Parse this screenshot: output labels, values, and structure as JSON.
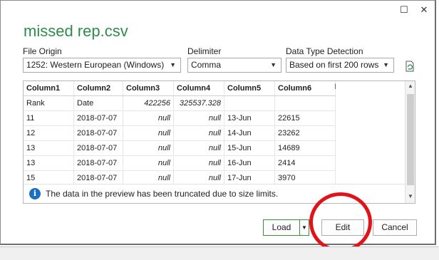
{
  "window": {
    "title": "missed rep.csv",
    "minimize_glyph": "☐",
    "close_glyph": "✕"
  },
  "options": {
    "file_origin_label": "File Origin",
    "file_origin_value": "1252: Western European (Windows)",
    "delimiter_label": "Delimiter",
    "delimiter_value": "Comma",
    "detection_label": "Data Type Detection",
    "detection_value": "Based on first 200 rows"
  },
  "grid": {
    "columns": [
      "Column1",
      "Column2",
      "Column3",
      "Column4",
      "Column5",
      "Column6"
    ],
    "partial_column": "I",
    "rows": [
      [
        "Rank",
        "Date",
        "422256",
        "325537.328",
        "",
        ""
      ],
      [
        "11",
        "2018-07-07",
        "null",
        "null",
        "13-Jun",
        "22615"
      ],
      [
        "12",
        "2018-07-07",
        "null",
        "null",
        "14-Jun",
        "23262"
      ],
      [
        "13",
        "2018-07-07",
        "null",
        "null",
        "15-Jun",
        "14689"
      ],
      [
        "13",
        "2018-07-07",
        "null",
        "null",
        "16-Jun",
        "2414"
      ],
      [
        "15",
        "2018-07-07",
        "null",
        "null",
        "17-Jun",
        "3970"
      ]
    ],
    "truncation_message": "The data in the preview has been truncated due to size limits."
  },
  "buttons": {
    "load": "Load",
    "edit": "Edit",
    "cancel": "Cancel"
  },
  "colors": {
    "title": "#2e8b4e",
    "annotation_circle": "#e0131a",
    "info_icon": "#1a6fc0"
  },
  "icons": [
    "refresh-icon",
    "info-icon",
    "chevron-down-icon"
  ]
}
